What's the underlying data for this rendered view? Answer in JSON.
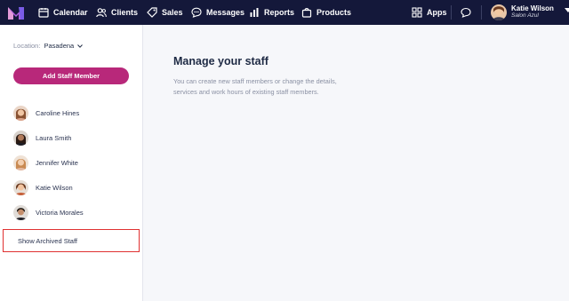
{
  "topbar": {
    "nav": [
      {
        "label": "Calendar",
        "icon": "calendar-icon"
      },
      {
        "label": "Clients",
        "icon": "clients-icon"
      },
      {
        "label": "Sales",
        "icon": "tag-icon"
      },
      {
        "label": "Messages",
        "icon": "message-icon"
      },
      {
        "label": "Reports",
        "icon": "bar-chart-icon"
      },
      {
        "label": "Products",
        "icon": "bag-icon"
      }
    ],
    "apps_label": "Apps",
    "user": {
      "name": "Katie Wilson",
      "salon": "Salon Azul"
    },
    "colors": {
      "bar": "#14183a",
      "logo": "#b25fe0"
    }
  },
  "sidebar": {
    "location_label": "Location:",
    "location_value": "Pasadena",
    "add_button_label": "Add Staff Member",
    "staff": [
      {
        "name": "Caroline Hines"
      },
      {
        "name": "Laura Smith"
      },
      {
        "name": "Jennifer White"
      },
      {
        "name": "Katie Wilson"
      },
      {
        "name": "Victoria Morales"
      }
    ],
    "archived_label": "Show Archived Staff"
  },
  "main": {
    "title": "Manage your staff",
    "description": "You can create new staff members or change the details, services and work hours of existing staff members."
  },
  "colors": {
    "accent": "#b8287a",
    "highlight": "#e03131"
  }
}
